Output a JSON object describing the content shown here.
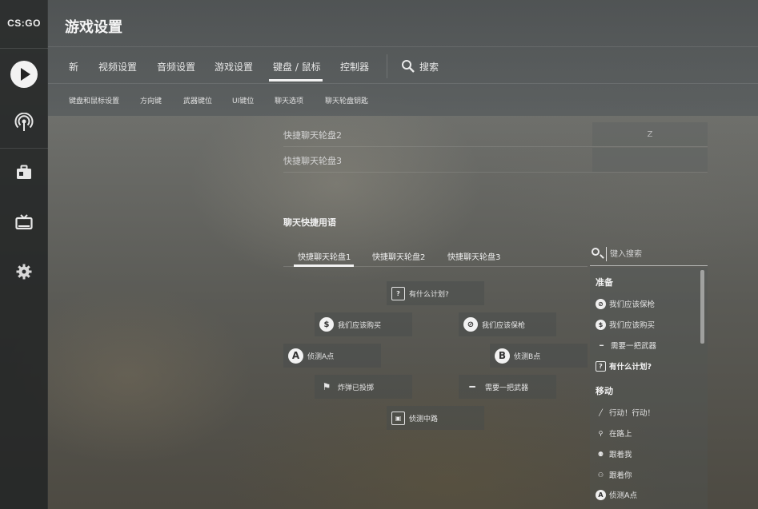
{
  "app": {
    "logo_text": "CS:GO",
    "title": "游戏设置"
  },
  "sidebar": {
    "items": [
      {
        "name": "play",
        "icon": "play-icon"
      },
      {
        "name": "broadcast",
        "icon": "broadcast-icon"
      },
      {
        "name": "inventory",
        "icon": "briefcase-icon"
      },
      {
        "name": "watch",
        "icon": "tv-icon"
      },
      {
        "name": "settings",
        "icon": "gear-icon"
      }
    ]
  },
  "tabs": [
    {
      "label": "新"
    },
    {
      "label": "视频设置"
    },
    {
      "label": "音频设置"
    },
    {
      "label": "游戏设置"
    },
    {
      "label": "键盘 / 鼠标",
      "active": true
    },
    {
      "label": "控制器"
    },
    {
      "label": "搜索"
    }
  ],
  "subtabs": [
    {
      "label": "键盘和鼠标设置"
    },
    {
      "label": "方向键"
    },
    {
      "label": "武器键位"
    },
    {
      "label": "UI键位"
    },
    {
      "label": "聊天选项"
    },
    {
      "label": "聊天轮盘钥匙"
    }
  ],
  "bindings": [
    {
      "label": "快捷聊天轮盘2",
      "key": "Z"
    },
    {
      "label": "快捷聊天轮盘3",
      "key": ""
    }
  ],
  "chat_section": {
    "title": "聊天快捷用语",
    "wheel_tabs": [
      {
        "label": "快捷聊天轮盘1",
        "active": true
      },
      {
        "label": "快捷聊天轮盘2"
      },
      {
        "label": "快捷聊天轮盘3"
      }
    ],
    "wheel": [
      {
        "label": "有什么计划?",
        "icon_text": "?",
        "icon": "plan-icon"
      },
      {
        "label": "我们应该购买",
        "icon_text": "$",
        "icon": "buy-icon"
      },
      {
        "label": "我们应该保枪",
        "icon_text": "⊘",
        "icon": "save-icon"
      },
      {
        "label": "侦测A点",
        "icon_text": "A",
        "icon": "site-a-icon"
      },
      {
        "label": "侦测B点",
        "icon_text": "B",
        "icon": "site-b-icon"
      },
      {
        "label": "炸弹已投掷",
        "icon_text": "⚑",
        "icon": "bomb-planted-icon"
      },
      {
        "label": "需要一把武器",
        "icon_text": "━",
        "icon": "rifle-icon"
      },
      {
        "label": "侦测中路",
        "icon_text": "▣",
        "icon": "mid-icon"
      }
    ]
  },
  "search": {
    "placeholder": "键入搜索"
  },
  "command_list": {
    "groups": [
      {
        "title": "准备",
        "items": [
          {
            "label": "我们应该保枪",
            "icon_text": "⊘",
            "icon": "save-icon"
          },
          {
            "label": "我们应该购买",
            "icon_text": "$",
            "icon": "buy-icon"
          },
          {
            "label": "需要一把武器",
            "icon_text": "━",
            "icon": "rifle-icon"
          },
          {
            "label": "有什么计划?",
            "icon_text": "?",
            "icon": "plan-icon"
          }
        ]
      },
      {
        "title": "移动",
        "items": [
          {
            "label": "行动！行动！",
            "icon_text": "╱",
            "icon": "go-icon"
          },
          {
            "label": "在路上",
            "icon_text": "⚲",
            "icon": "on-my-way-icon"
          },
          {
            "label": "跟着我",
            "icon_text": "⚉",
            "icon": "follow-me-icon"
          },
          {
            "label": "跟着你",
            "icon_text": "⚇",
            "icon": "follow-you-icon"
          },
          {
            "label": "侦测A点",
            "icon_text": "A",
            "icon": "site-a-icon"
          }
        ]
      }
    ]
  }
}
